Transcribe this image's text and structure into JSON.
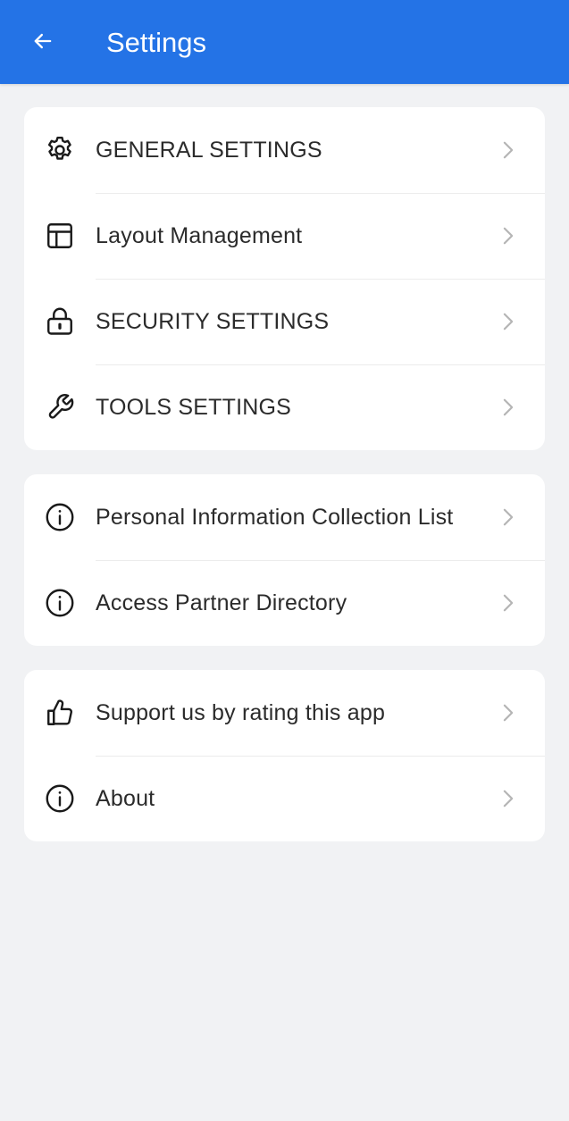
{
  "header": {
    "title": "Settings",
    "back_icon": "arrow-left-icon",
    "background": "#2473e6"
  },
  "groups": [
    {
      "items": [
        {
          "label": "GENERAL SETTINGS",
          "icon": "gear-icon"
        },
        {
          "label": "Layout Management",
          "icon": "layout-icon"
        },
        {
          "label": "SECURITY SETTINGS",
          "icon": "lock-icon"
        },
        {
          "label": "TOOLS SETTINGS",
          "icon": "wrench-icon"
        }
      ]
    },
    {
      "items": [
        {
          "label": "Personal Information Collection List",
          "icon": "info-icon"
        },
        {
          "label": "Access Partner Directory",
          "icon": "info-icon"
        }
      ]
    },
    {
      "items": [
        {
          "label": "Support us by rating this app",
          "icon": "thumbs-up-icon"
        },
        {
          "label": "About",
          "icon": "info-icon"
        }
      ]
    }
  ],
  "chevron_icon": "chevron-right-icon"
}
